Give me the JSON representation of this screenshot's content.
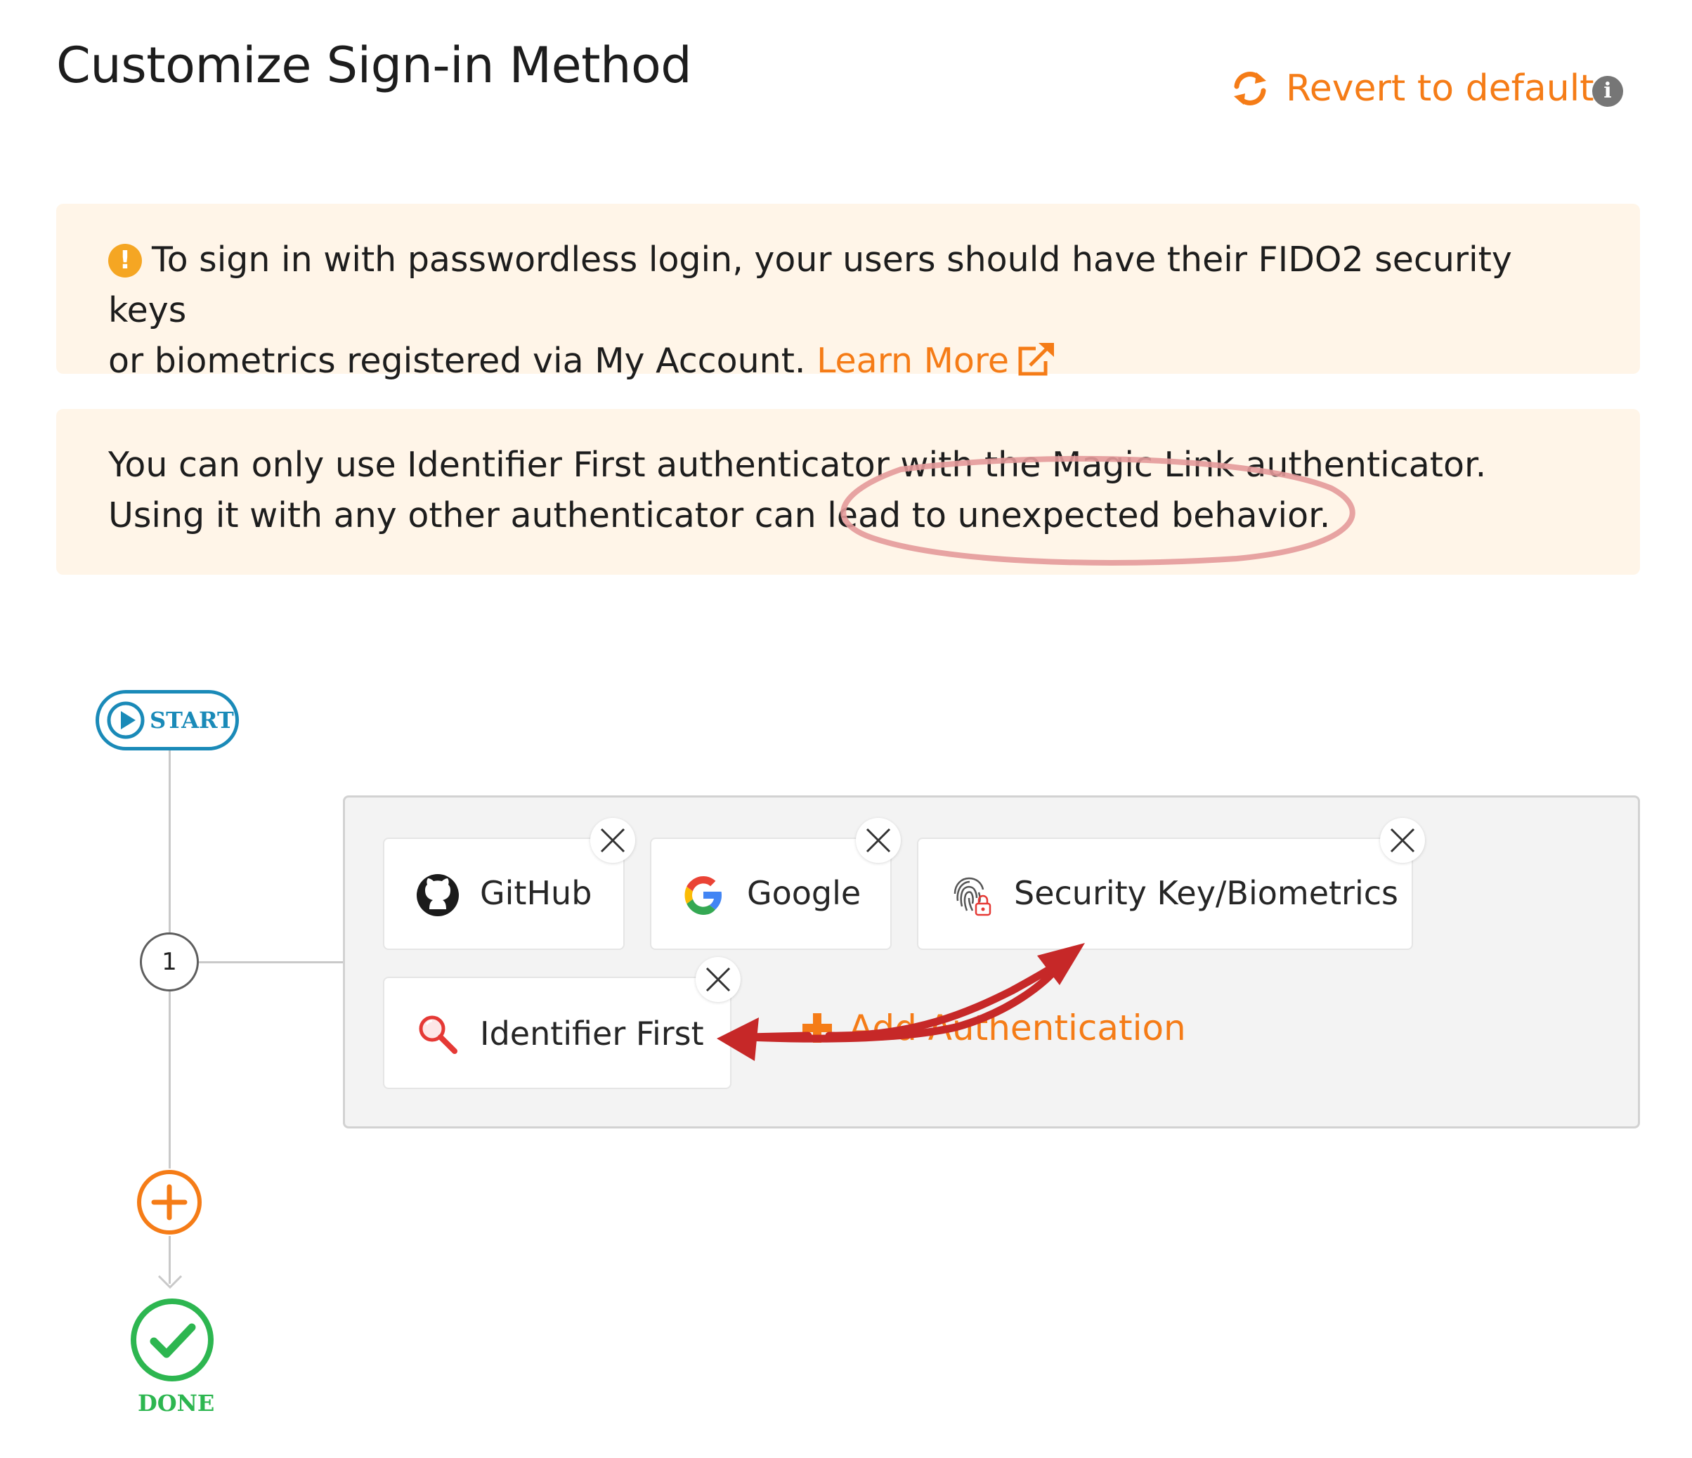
{
  "header": {
    "title": "Customize Sign-in Method",
    "revert_label": "Revert to default",
    "revert_icon": "refresh-icon",
    "info_icon": "info-icon",
    "info_glyph": "i"
  },
  "banners": [
    {
      "icon": "warning-icon",
      "icon_glyph": "!",
      "line1": "To sign in with passwordless login, your users should have their FIDO2 security keys",
      "line2": "or biometrics registered via My Account.",
      "link_label": "Learn More",
      "link_icon": "external-link-icon"
    },
    {
      "line1": "You can only use Identifier First authenticator with the Magic Link authenticator.",
      "line2": "Using it with any other authenticator can lead to unexpected behavior."
    }
  ],
  "flow": {
    "start_label": "START",
    "step_number": "1",
    "done_label": "DONE",
    "authenticators": [
      {
        "label": "GitHub",
        "icon": "github-icon"
      },
      {
        "label": "Google",
        "icon": "google-icon"
      },
      {
        "label": "Security Key/Biometrics",
        "icon": "fingerprint-icon"
      },
      {
        "label": "Identifier First",
        "icon": "magnifier-icon"
      }
    ],
    "add_authentication_label": "Add Authentication"
  },
  "colors": {
    "accent_orange": "#f57c17",
    "banner_background": "#fff5e8",
    "start_blue": "#1a8ab8",
    "done_green": "#2db650",
    "annotation_red": "#c62828",
    "annotation_circle": "#e49a9a"
  }
}
